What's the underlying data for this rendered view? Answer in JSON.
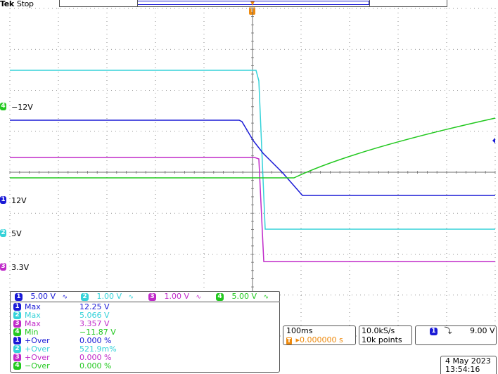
{
  "header": {
    "brand": "Tek",
    "mode": "Stop"
  },
  "trigger": {
    "marker": "T"
  },
  "colors": {
    "ch1": "#1a1ad6",
    "ch2": "#35d2d9",
    "ch3": "#c02ac9",
    "ch4": "#22c81f",
    "grid": "#6e6e6e",
    "orange": "#ee8a0e"
  },
  "channel_labels": [
    {
      "num": "4",
      "text": "−12V"
    },
    {
      "num": "1",
      "text": "12V"
    },
    {
      "num": "2",
      "text": "5V"
    },
    {
      "num": "3",
      "text": "3.3V"
    }
  ],
  "channel_scales": [
    {
      "num": "1",
      "scale": "5.00 V",
      "bw": "∿"
    },
    {
      "num": "2",
      "scale": "1.00 V",
      "bw": "∿"
    },
    {
      "num": "3",
      "scale": "1.00 V",
      "bw": "∿"
    },
    {
      "num": "4",
      "scale": "5.00 V",
      "bw": "∿"
    }
  ],
  "measurements": [
    {
      "ch": "1",
      "name": "Max",
      "value": "12.25 V"
    },
    {
      "ch": "2",
      "name": "Max",
      "value": "5.066 V"
    },
    {
      "ch": "3",
      "name": "Max",
      "value": "3.357 V"
    },
    {
      "ch": "4",
      "name": "Min",
      "value": "−11.87 V"
    },
    {
      "ch": "1",
      "name": "+Over",
      "value": "0.000 %"
    },
    {
      "ch": "2",
      "name": "+Over",
      "value": "521.9m%"
    },
    {
      "ch": "3",
      "name": "+Over",
      "value": "0.000 %"
    },
    {
      "ch": "4",
      "name": "−Over",
      "value": "0.000 %"
    }
  ],
  "timebase": {
    "scale": "100ms",
    "position": "▸0.000000 s",
    "pos_marker": "T"
  },
  "acquisition": {
    "rate": "10.0kS/s",
    "length": "10k points"
  },
  "trigger_settings": {
    "ch": "1",
    "slope": "⤵",
    "level": "9.00 V"
  },
  "datetime": {
    "date": "4 May 2023",
    "time": "13:54:16"
  }
}
